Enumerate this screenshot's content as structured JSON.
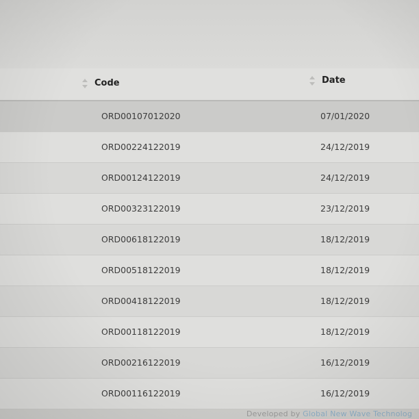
{
  "table": {
    "headers": {
      "code": "Code",
      "date": "Date"
    },
    "rows": [
      {
        "code": "ORD00107012020",
        "date": "07/01/2020"
      },
      {
        "code": "ORD00224122019",
        "date": "24/12/2019"
      },
      {
        "code": "ORD00124122019",
        "date": "24/12/2019"
      },
      {
        "code": "ORD00323122019",
        "date": "23/12/2019"
      },
      {
        "code": "ORD00618122019",
        "date": "18/12/2019"
      },
      {
        "code": "ORD00518122019",
        "date": "18/12/2019"
      },
      {
        "code": "ORD00418122019",
        "date": "18/12/2019"
      },
      {
        "code": "ORD00118122019",
        "date": "18/12/2019"
      },
      {
        "code": "ORD00216122019",
        "date": "16/12/2019"
      },
      {
        "code": "ORD00116122019",
        "date": "16/12/2019"
      }
    ]
  },
  "footer": {
    "prefix": "Developed by ",
    "brand": "Global New Wave Technolog"
  },
  "icons": {
    "sort": "sort-icon"
  }
}
